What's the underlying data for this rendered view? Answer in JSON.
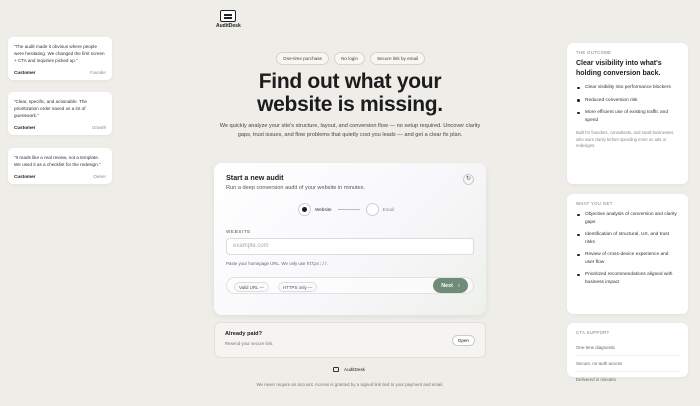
{
  "brand": {
    "name": "AuditDesk"
  },
  "testimonials": [
    {
      "quote": "“The audit made it obvious where people were hesitating. We changed the first screen + CTA and inquiries picked up.”",
      "who": "Customer",
      "role": "Founder"
    },
    {
      "quote": "“Clear, specific, and actionable. The prioritization order saved us a lot of guesswork.”",
      "who": "Customer",
      "role": "Growth"
    },
    {
      "quote": "“It reads like a real review, not a template. We used it as a checklist for the redesign.”",
      "who": "Customer",
      "role": "Owner"
    }
  ],
  "pills": [
    "One-time purchase",
    "No login",
    "Secure link by email"
  ],
  "hero": {
    "title_line1": "Find out what your",
    "title_line2": "website is missing.",
    "subtitle": "We quickly analyze your site's structure, layout, and conversion flow — no setup required. Uncover clarity gaps, trust issues, and flow problems that quietly cost you leads — and get a clear fix plan."
  },
  "card": {
    "title": "Start a new audit",
    "subtitle": "Run a deep conversion audit of your website in minutes.",
    "icon": "refresh-icon",
    "steps": [
      {
        "label": "Website"
      },
      {
        "label": "Email"
      }
    ],
    "field_label": "WEBSITE",
    "field_placeholder": "example.com",
    "hint_prefix": "Paste your homepage URL. We only use",
    "hint_code": "https://",
    "hint_suffix": ".",
    "chips": [
      "Valid URL —",
      "HTTPS only —"
    ],
    "next_label": "Next",
    "next_arrow": "›"
  },
  "paid": {
    "title": "Already paid?",
    "subtitle": "Resend your secure link.",
    "open_label": "Open"
  },
  "footer": {
    "brand": "AuditDesk",
    "note": "We never require an account. Access is granted by a signed link tied to your payment and email."
  },
  "outcome": {
    "eyebrow": "THE OUTCOME",
    "title": "Clear visibility into what's holding conversion back.",
    "items": [
      "Clear visibility into performance blockers",
      "Reduced conversion risk",
      "More efficient use of existing traffic and spend"
    ],
    "note": "Built for founders, consultants, and small businesses who want clarity before spending more on ads or redesigns."
  },
  "what_you_get": {
    "eyebrow": "WHAT YOU GET",
    "items": [
      "Objective analysis of conversion and clarity gaps",
      "Identification of structural, UX, and trust risks",
      "Review of cross-device experience and user flow",
      "Prioritized recommendations aligned with business impact"
    ]
  },
  "cta_support": {
    "eyebrow": "CTA SUPPORT",
    "items": [
      "One-time diagnostic",
      "Secure, no-auth access",
      "Delivered in minutes"
    ]
  },
  "colors": {
    "accent": "#6e8c78",
    "background": "#efede8"
  }
}
